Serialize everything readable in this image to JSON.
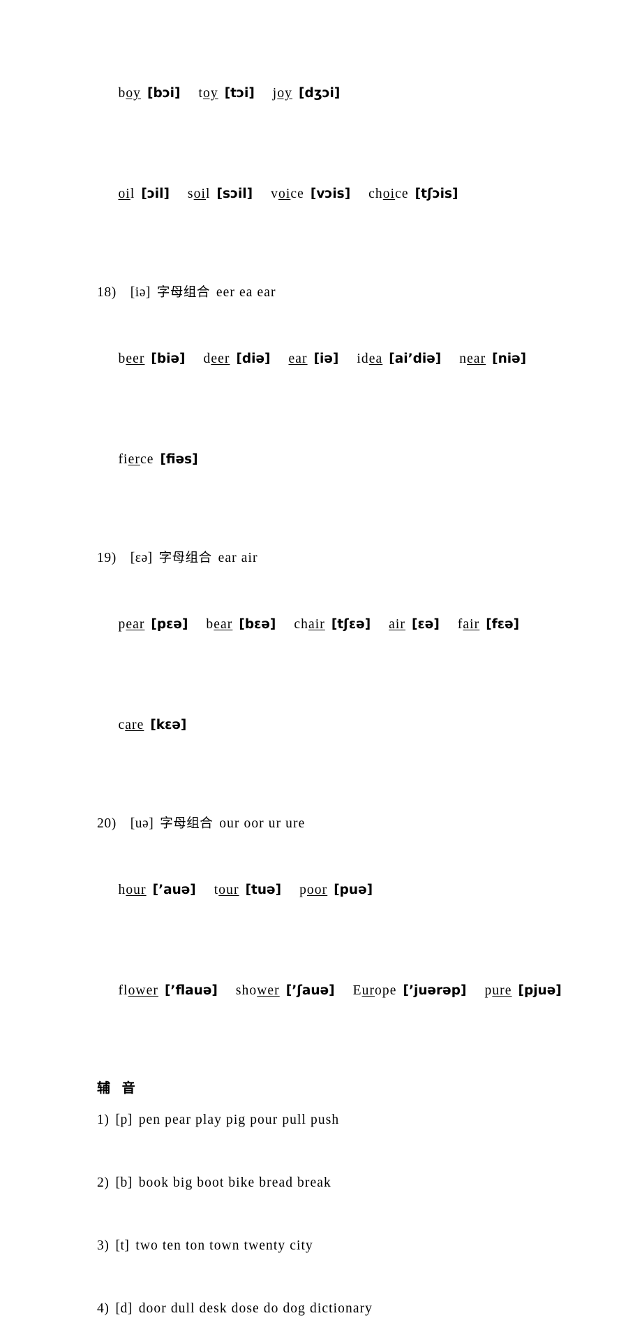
{
  "document": {
    "type": "english-phonetics-worksheet",
    "language_note": "Chinese-annotated English pronunciation practice sheet",
    "page_background": "#ffffff",
    "text_color": "#000000"
  },
  "diphthong_sections": [
    {
      "id": "sec-17-continuation",
      "number": "",
      "symbol": "",
      "label": "",
      "combos": "",
      "rows": [
        {
          "entries": [
            {
              "word_pre": "b",
              "word_underlined": "oy",
              "word_post": "",
              "ipa": "[bɔi]"
            },
            {
              "word_pre": "t",
              "word_underlined": "oy",
              "word_post": "",
              "ipa": "[tɔi]"
            },
            {
              "word_pre": "j",
              "word_underlined": "oy",
              "word_post": "",
              "ipa": "[dʒɔi]"
            }
          ]
        },
        {
          "entries": [
            {
              "word_pre": "",
              "word_underlined": "oi",
              "word_post": "l",
              "ipa": "[ɔil]"
            },
            {
              "word_pre": "s",
              "word_underlined": "oi",
              "word_post": "l",
              "ipa": "[sɔil]"
            },
            {
              "word_pre": "v",
              "word_underlined": "oi",
              "word_post": "ce",
              "ipa": "[vɔis]"
            },
            {
              "word_pre": "ch",
              "word_underlined": "oi",
              "word_post": "ce",
              "ipa": "[tʃɔis]"
            }
          ]
        }
      ]
    },
    {
      "id": "sec-18",
      "number": "18)",
      "symbol": "[iə]",
      "label": "字母组合",
      "combos": "eer ea ear",
      "rows": [
        {
          "entries": [
            {
              "word_pre": "b",
              "word_underlined": "eer",
              "word_post": "",
              "ipa": "[biə]"
            },
            {
              "word_pre": "d",
              "word_underlined": "eer",
              "word_post": "",
              "ipa": "[diə]"
            },
            {
              "word_pre": "",
              "word_underlined": "ear",
              "word_post": "",
              "ipa": "[iə]"
            },
            {
              "word_pre": "id",
              "word_underlined": "ea",
              "word_post": "",
              "ipa": "[ai’diə]"
            },
            {
              "word_pre": "n",
              "word_underlined": "ear",
              "word_post": "",
              "ipa": "[niə]"
            }
          ]
        },
        {
          "entries": [
            {
              "word_pre": "fi",
              "word_underlined": "er",
              "word_post": "ce",
              "ipa": "[fiəs]"
            }
          ]
        }
      ]
    },
    {
      "id": "sec-19",
      "number": "19)",
      "symbol": "[ɛə]",
      "label": "字母组合",
      "combos": "ear air",
      "rows": [
        {
          "entries": [
            {
              "word_pre": "p",
              "word_underlined": "ear",
              "word_post": "",
              "ipa": "[pɛə]"
            },
            {
              "word_pre": "b",
              "word_underlined": "ear",
              "word_post": "",
              "ipa": "[bɛə]"
            },
            {
              "word_pre": "ch",
              "word_underlined": "air",
              "word_post": "",
              "ipa": "[tʃɛə]"
            },
            {
              "word_pre": "",
              "word_underlined": "air",
              "word_post": "",
              "ipa": "[ɛə]"
            },
            {
              "word_pre": "f",
              "word_underlined": "air",
              "word_post": "",
              "ipa": "[fɛə]"
            }
          ]
        },
        {
          "entries": [
            {
              "word_pre": "c",
              "word_underlined": "are",
              "word_post": "",
              "ipa": "[kɛə]"
            }
          ]
        }
      ]
    },
    {
      "id": "sec-20",
      "number": "20)",
      "symbol": "[uə]",
      "label": "字母组合",
      "combos": "our oor ur ure",
      "rows": [
        {
          "entries": [
            {
              "word_pre": "h",
              "word_underlined": "our",
              "word_post": "",
              "ipa": "[’auə]"
            },
            {
              "word_pre": "t",
              "word_underlined": "our",
              "word_post": "",
              "ipa": "[tuə]"
            },
            {
              "word_pre": "p",
              "word_underlined": "oor",
              "word_post": "",
              "ipa": "[puə]"
            }
          ]
        },
        {
          "entries": [
            {
              "word_pre": "fl",
              "word_underlined": "ower",
              "word_post": "",
              "ipa": "[’flauə]"
            },
            {
              "word_pre": "sho",
              "word_underlined": "wer",
              "word_post": "",
              "ipa": "[’ʃauə]"
            },
            {
              "word_pre": "E",
              "word_underlined": "ur",
              "word_post": "ope",
              "ipa": "[’juərəp]"
            },
            {
              "word_pre": "p",
              "word_underlined": "ure",
              "word_post": "",
              "ipa": "[pjuə]"
            }
          ]
        }
      ]
    }
  ],
  "consonant_section": {
    "heading": "辅 音",
    "items": [
      {
        "number": "1)",
        "symbol": "[p]",
        "words": "pen pear play pig pour pull push"
      },
      {
        "number": "2)",
        "symbol": "[b]",
        "words": "book big boot bike bread break"
      },
      {
        "number": "3)",
        "symbol": "[t]",
        "words": "two ten ton town twenty city"
      },
      {
        "number": "4)",
        "symbol": "[d]",
        "words": "door dull desk dose do dog dictionary"
      }
    ]
  }
}
